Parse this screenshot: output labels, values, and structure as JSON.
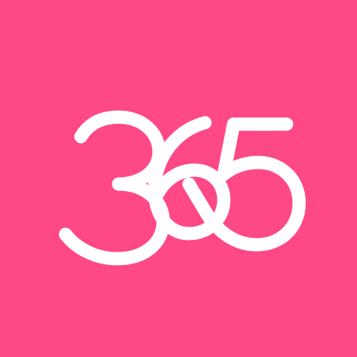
{
  "logo": {
    "text": "365",
    "background_color": "#ff4886",
    "foreground_color": "#ffffff"
  }
}
